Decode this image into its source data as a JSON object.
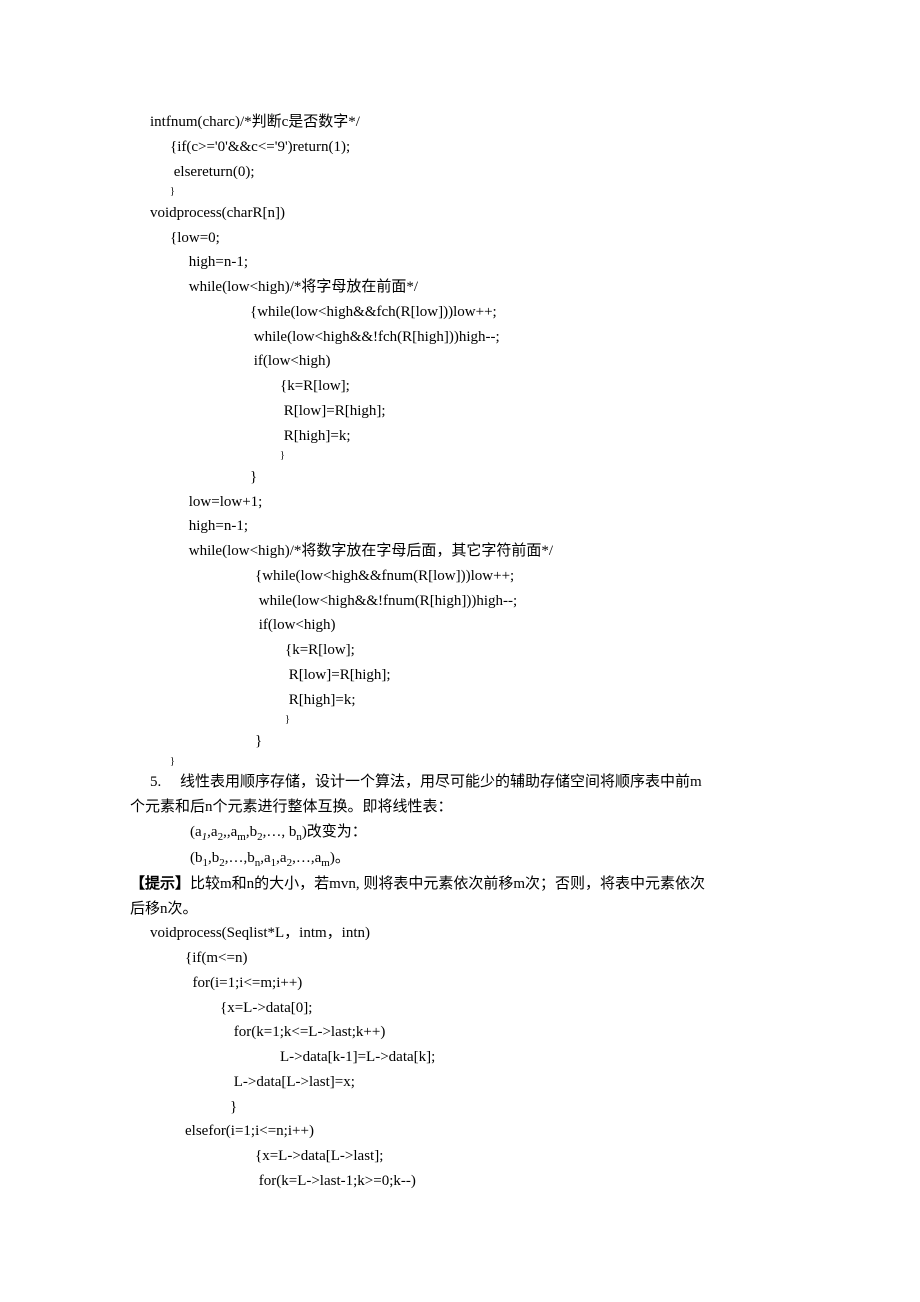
{
  "code_block_1": {
    "l1": "intfnum(charc)/*判断c是否数字*/",
    "l2": "{if(c>='0'&&c<='9')return(1);",
    "l3": " elsereturn(0);",
    "l4": "}",
    "l5": "voidprocess(charR[n])",
    "l6": "{low=0;",
    "l7": " high=n-1;",
    "l8": " while(low<high)/*将字母放在前面*/",
    "l9": "{while(low<high&&fch(R[low]))low++;",
    "l10": " while(low<high&&!fch(R[high]))high--;",
    "l11": " if(low<high)",
    "l12": "{k=R[low];",
    "l13": " R[low]=R[high];",
    "l14": " R[high]=k;",
    "l15": "}",
    "l16": "}",
    "l17": " low=low+1;",
    "l18": " high=n-1;",
    "l19": " while(low<high)/*将数字放在字母后面，其它字符前面*/",
    "l20": "{while(low<high&&fnum(R[low]))low++;",
    "l21": " while(low<high&&!fnum(R[high]))high--;",
    "l22": " if(low<high)",
    "l23": "{k=R[low];",
    "l24": " R[low]=R[high];",
    "l25": " R[high]=k;",
    "l26": "}",
    "l27": "}",
    "l28": "}"
  },
  "question5": {
    "num": "5.",
    "text_a": "线性表用顺序存储，设计一个算法，用尽可能少的辅助存储空间将顺序表中前m",
    "text_b": "个元素和后n个元素进行整体互换。即将线性表：",
    "formula1_pre": "(a",
    "formula1_sub1": "1",
    "formula1_mid1": ",a",
    "formula1_sub2": "2",
    "formula1_mid2": ",,a",
    "formula1_sub3": "m",
    "formula1_mid3": ",b",
    "formula1_sub4": "2",
    "formula1_mid4": ",…,  b",
    "formula1_sub5": "n",
    "formula1_end": ")改变为：",
    "formula2_pre": "(b",
    "formula2_s1": "1",
    "formula2_m1": ",b",
    "formula2_s2": "2",
    "formula2_m2": ",…,b",
    "formula2_s3": "n",
    "formula2_m3": ",a",
    "formula2_s4": "1",
    "formula2_m4": ",a",
    "formula2_s5": "2",
    "formula2_m5": ",…,a",
    "formula2_s6": "m",
    "formula2_end": ")。",
    "hint_label": "【提示】",
    "hint_a": "比较m和n的大小，若mvn, 则将表中元素依次前移m次；否则，将表中元素依次",
    "hint_b": "后移n次。"
  },
  "code_block_2": {
    "l1": "voidprocess(Seqlist*L，intm，intn)",
    "l2": "{if(m<=n)",
    "l3": "  for(i=1;i<=m;i++)",
    "l4": "{x=L->data[0];",
    "l5": " for(k=1;k<=L->last;k++)",
    "l6": "L->data[k-1]=L->data[k];",
    "l7": " L->data[L->last]=x;",
    "l8": "}",
    "l9": "elsefor(i=1;i<=n;i++)",
    "l10": "{x=L->data[L->last];",
    "l11": " for(k=L->last-1;k>=0;k--)"
  }
}
